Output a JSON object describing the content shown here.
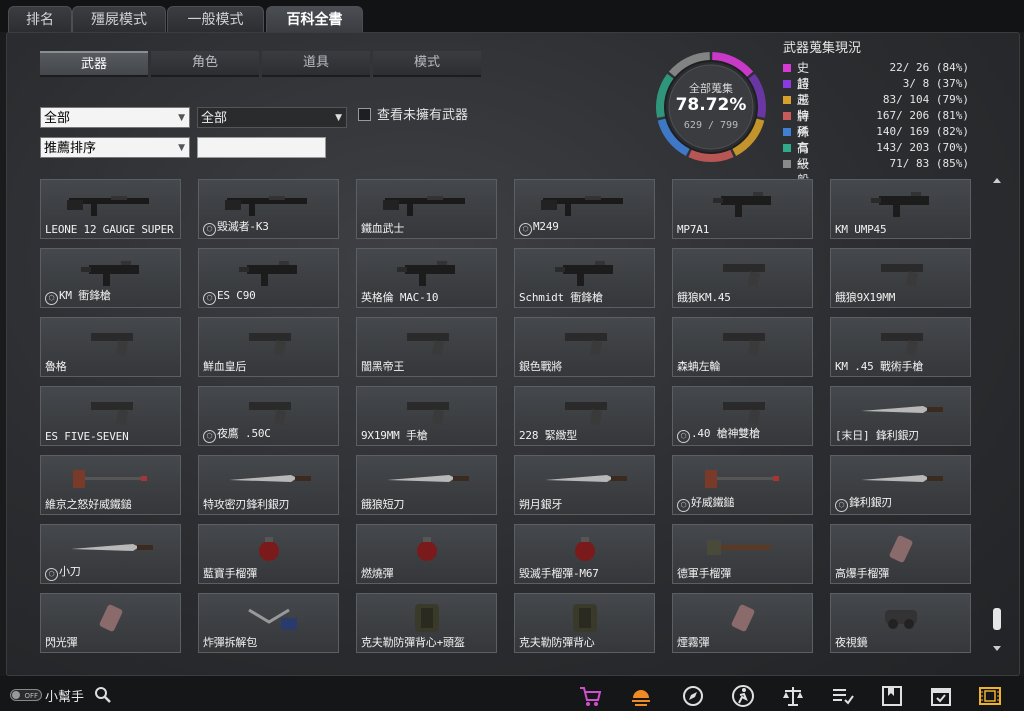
{
  "top_tabs": [
    {
      "label": "排名"
    },
    {
      "label": "殭屍模式"
    },
    {
      "label": "一般模式"
    },
    {
      "label": "百科全書"
    }
  ],
  "sub_tabs": [
    {
      "label": "武器"
    },
    {
      "label": "角色"
    },
    {
      "label": "道具"
    },
    {
      "label": "模式"
    }
  ],
  "filters": {
    "type_select": "全部",
    "sub_select": "全部",
    "sort_select": "推薦排序",
    "show_unowned_label": "查看未擁有武器"
  },
  "collection": {
    "label": "全部蒐集",
    "percent": "78.72%",
    "count": "629 / 799",
    "fraction": 0.7872
  },
  "stats": {
    "title": "武器蒐集現況",
    "rows": [
      {
        "name": "史詩",
        "value": "22/ 26 (84%)",
        "color": "#d63ad6",
        "fraction": 0.84
      },
      {
        "name": "超越",
        "value": " 3/ 8 (37%)",
        "color": "#8a3ae0",
        "fraction": 0.37
      },
      {
        "name": "王牌",
        "value": "83/ 104 (79%)",
        "color": "#d6a12a",
        "fraction": 0.79
      },
      {
        "name": "特殊",
        "value": "167/ 206 (81%)",
        "color": "#c85a5a",
        "fraction": 0.81
      },
      {
        "name": "稀有",
        "value": "140/ 169 (82%)",
        "color": "#3f7fd6",
        "fraction": 0.82
      },
      {
        "name": "高級",
        "value": "143/ 203 (70%)",
        "color": "#2faa8a",
        "fraction": 0.7
      },
      {
        "name": "一般",
        "value": "71/ 83 (85%)",
        "color": "#8a8a8a",
        "fraction": 0.85
      }
    ]
  },
  "items": [
    {
      "name": "LEONE 12 GAUGE SUPER",
      "badge": false,
      "art": "rifle"
    },
    {
      "name": "毀滅者-K3",
      "badge": true,
      "art": "rifle"
    },
    {
      "name": "鐵血武士",
      "badge": false,
      "art": "rifle"
    },
    {
      "name": "M249",
      "badge": true,
      "art": "rifle"
    },
    {
      "name": "MP7A1",
      "badge": false,
      "art": "smg"
    },
    {
      "name": "KM UMP45",
      "badge": false,
      "art": "smg"
    },
    {
      "name": "KM 衝鋒槍",
      "badge": true,
      "art": "smg"
    },
    {
      "name": "ES C90",
      "badge": true,
      "art": "smg"
    },
    {
      "name": "英格倫 MAC-10",
      "badge": false,
      "art": "smg"
    },
    {
      "name": "Schmidt 衝鋒槍",
      "badge": false,
      "art": "smg"
    },
    {
      "name": "餓狼KM.45",
      "badge": false,
      "art": "pistol"
    },
    {
      "name": "餓狼9X19MM",
      "badge": false,
      "art": "pistol"
    },
    {
      "name": "魯格",
      "badge": false,
      "art": "pistol"
    },
    {
      "name": "鮮血皇后",
      "badge": false,
      "art": "pistol"
    },
    {
      "name": "闇黑帝王",
      "badge": false,
      "art": "pistol"
    },
    {
      "name": "銀色戰將",
      "badge": false,
      "art": "pistol"
    },
    {
      "name": "森蚺左輪",
      "badge": false,
      "art": "pistol"
    },
    {
      "name": "KM .45 戰術手槍",
      "badge": false,
      "art": "pistol"
    },
    {
      "name": "ES FIVE-SEVEN",
      "badge": false,
      "art": "pistol"
    },
    {
      "name": "夜鷹 .50C",
      "badge": true,
      "art": "pistol"
    },
    {
      "name": "9X19MM 手槍",
      "badge": false,
      "art": "pistol"
    },
    {
      "name": "228 緊緻型",
      "badge": false,
      "art": "pistol"
    },
    {
      "name": ".40 槍神雙槍",
      "badge": true,
      "art": "pistol"
    },
    {
      "name": "[末日] 鋒利銀刃",
      "badge": false,
      "art": "knife"
    },
    {
      "name": "維京之怒好威鐵鎚",
      "badge": false,
      "art": "hammer"
    },
    {
      "name": "特攻密刃鋒利銀刃",
      "badge": false,
      "art": "knife"
    },
    {
      "name": "餓狼短刀",
      "badge": false,
      "art": "knife"
    },
    {
      "name": "朔月銀牙",
      "badge": false,
      "art": "knife"
    },
    {
      "name": "好威鐵鎚",
      "badge": true,
      "art": "hammer"
    },
    {
      "name": "鋒利銀刃",
      "badge": true,
      "art": "knife"
    },
    {
      "name": "小刀",
      "badge": true,
      "art": "knife"
    },
    {
      "name": "藍寶手榴彈",
      "badge": false,
      "art": "grenade"
    },
    {
      "name": "燃燒彈",
      "badge": false,
      "art": "grenade"
    },
    {
      "name": "毀滅手榴彈-M67",
      "badge": false,
      "art": "grenade"
    },
    {
      "name": "德軍手榴彈",
      "badge": false,
      "art": "stick"
    },
    {
      "name": "高爆手榴彈",
      "badge": false,
      "art": "canister"
    },
    {
      "name": "閃光彈",
      "badge": false,
      "art": "canister"
    },
    {
      "name": "炸彈拆解包",
      "badge": false,
      "art": "tool"
    },
    {
      "name": "克夫勒防彈背心+頭盔",
      "badge": false,
      "art": "vest"
    },
    {
      "name": "克夫勒防彈背心",
      "badge": false,
      "art": "vest"
    },
    {
      "name": "煙霧彈",
      "badge": false,
      "art": "canister"
    },
    {
      "name": "夜視鏡",
      "badge": false,
      "art": "goggles"
    }
  ],
  "bottom": {
    "toggle_label": "OFF",
    "helper_label": "小幫手"
  }
}
